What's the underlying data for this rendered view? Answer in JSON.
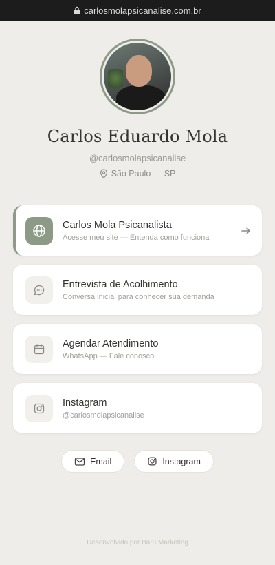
{
  "browser": {
    "url": "carlosmolapsicanalise.com.br"
  },
  "profile": {
    "name": "Carlos Eduardo Mola",
    "handle": "@carlosmolapsicanalise",
    "location": "São Paulo — SP"
  },
  "links": [
    {
      "title": "Carlos Mola Psicanalista",
      "subtitle": "Acesse meu site — Entenda como funciona",
      "icon": "globe-icon"
    },
    {
      "title": "Entrevista de Acolhimento",
      "subtitle": "Conversa inicial para conhecer sua demanda",
      "icon": "chat-icon"
    },
    {
      "title": "Agendar Atendimento",
      "subtitle": "WhatsApp — Fale conosco",
      "icon": "calendar-icon"
    },
    {
      "title": "Instagram",
      "subtitle": "@carlosmolapsicanalise",
      "icon": "instagram-icon"
    }
  ],
  "socials": [
    {
      "label": "Email",
      "icon": "mail-icon"
    },
    {
      "label": "Instagram",
      "icon": "instagram-icon"
    }
  ],
  "footer": {
    "text": "Desenvolvido por Baru Marketing"
  },
  "colors": {
    "accent": "#8c9a86",
    "background": "#efedea",
    "card": "#ffffff"
  }
}
